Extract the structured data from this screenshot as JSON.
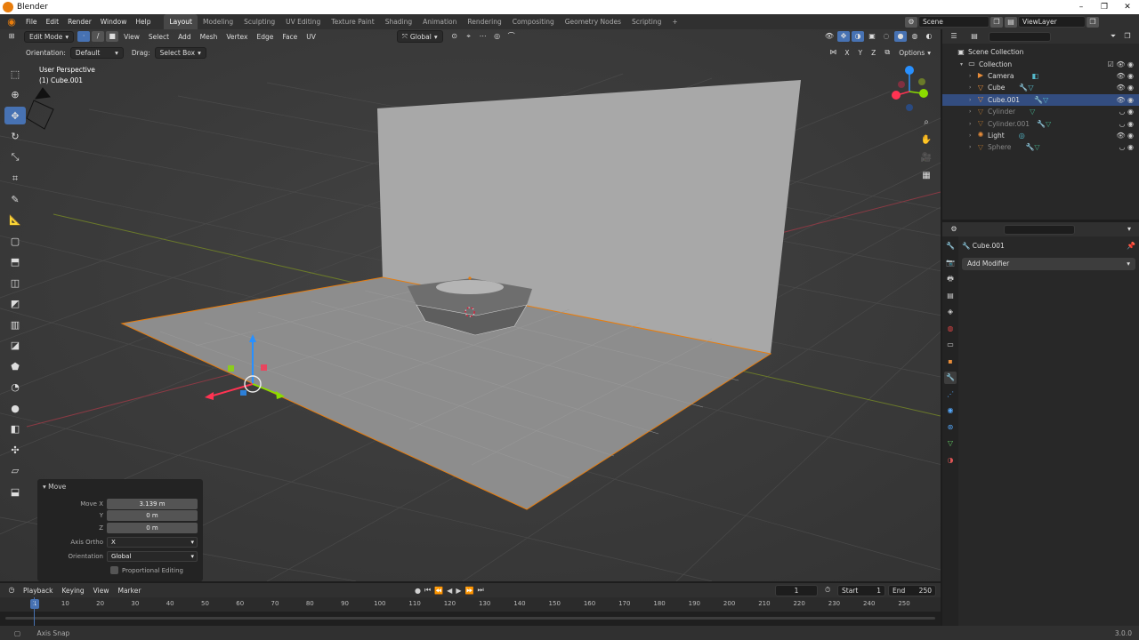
{
  "window": {
    "title": "Blender",
    "min": "–",
    "max": "❐",
    "close": "✕"
  },
  "menubar": {
    "menus": [
      "File",
      "Edit",
      "Render",
      "Window",
      "Help"
    ],
    "workspaces": [
      "Layout",
      "Modeling",
      "Sculpting",
      "UV Editing",
      "Texture Paint",
      "Shading",
      "Animation",
      "Rendering",
      "Compositing",
      "Geometry Nodes",
      "Scripting"
    ],
    "add_tab": "+",
    "scene": "Scene",
    "view_layer": "ViewLayer"
  },
  "viewport": {
    "mode": "Edit Mode",
    "menus": [
      "View",
      "Select",
      "Add",
      "Mesh",
      "Vertex",
      "Edge",
      "Face",
      "UV"
    ],
    "transform_orientation": "Global",
    "orientation_label": "Orientation:",
    "orientation_value": "Default",
    "drag_label": "Drag:",
    "drag_value": "Select Box",
    "options": "Options",
    "axis_x": "X",
    "axis_y": "Y",
    "axis_z": "Z",
    "perspective": "User Perspective",
    "object": "(1) Cube.001"
  },
  "operator_panel": {
    "title": "Move",
    "move_x_label": "Move X",
    "move_x": "3.139 m",
    "y_label": "Y",
    "y": "0 m",
    "z_label": "Z",
    "z": "0 m",
    "axis_ortho_label": "Axis Ortho",
    "axis_ortho": "X",
    "orientation_label": "Orientation",
    "orientation": "Global",
    "proportional": "Proportional Editing"
  },
  "outliner": {
    "scene_collection": "Scene Collection",
    "collection": "Collection",
    "items": [
      {
        "name": "Camera",
        "icon": "camera-icon",
        "selected": false,
        "hidden": false
      },
      {
        "name": "Cube",
        "icon": "mesh-icon",
        "selected": false,
        "hidden": false
      },
      {
        "name": "Cube.001",
        "icon": "mesh-icon",
        "selected": true,
        "hidden": false
      },
      {
        "name": "Cylinder",
        "icon": "mesh-icon",
        "selected": false,
        "hidden": true
      },
      {
        "name": "Cylinder.001",
        "icon": "mesh-icon",
        "selected": false,
        "hidden": true
      },
      {
        "name": "Light",
        "icon": "light-icon",
        "selected": false,
        "hidden": false
      },
      {
        "name": "Sphere",
        "icon": "mesh-icon",
        "selected": false,
        "hidden": true
      }
    ]
  },
  "properties": {
    "object_name": "Cube.001",
    "add_modifier": "Add Modifier"
  },
  "timeline": {
    "menus": [
      "Playback",
      "Keying",
      "View",
      "Marker"
    ],
    "current_frame": "1",
    "start_label": "Start",
    "start": "1",
    "end_label": "End",
    "end": "250",
    "ticks": [
      "10",
      "20",
      "30",
      "40",
      "50",
      "60",
      "70",
      "80",
      "90",
      "100",
      "110",
      "120",
      "130",
      "140",
      "150",
      "160",
      "170",
      "180",
      "190",
      "200",
      "210",
      "220",
      "230",
      "240",
      "250"
    ],
    "playhead": "1"
  },
  "statusbar": {
    "hint": "Axis Snap",
    "version": "3.0.0"
  },
  "colors": {
    "accent": "#4772b3",
    "selection": "#e87d0d",
    "x_axis": "#ff3352",
    "y_axis": "#8bdc00",
    "z_axis": "#2890ff"
  }
}
